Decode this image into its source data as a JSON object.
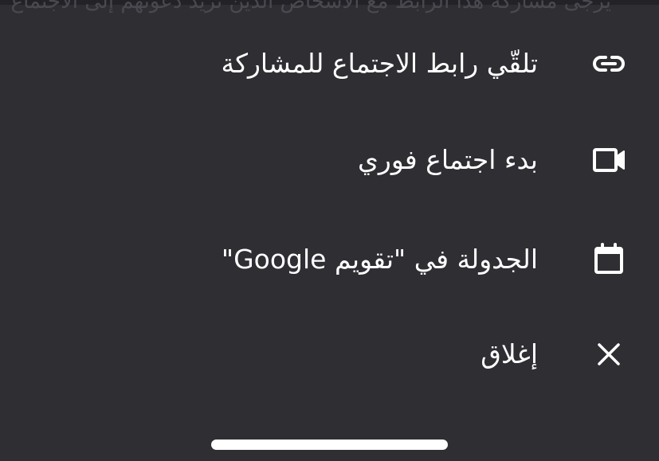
{
  "background_text": "يرجى مشاركة هذا الرابط مع الأشخاص الذين تريد دعوتهم إلى الاجتماع",
  "menu": {
    "items": [
      {
        "id": "get-link",
        "label": "تلقّي رابط الاجتماع للمشاركة",
        "icon": "link-icon"
      },
      {
        "id": "instant-meeting",
        "label": "بدء اجتماع فوري",
        "icon": "video-camera-icon"
      },
      {
        "id": "schedule",
        "label": "الجدولة في \"تقويم Google\"",
        "icon": "calendar-icon"
      },
      {
        "id": "close",
        "label": "إغلاق",
        "icon": "close-icon"
      }
    ]
  },
  "colors": {
    "sheet_background": "#2f2e33",
    "text": "#ffffff",
    "home_indicator": "#ffffff"
  }
}
